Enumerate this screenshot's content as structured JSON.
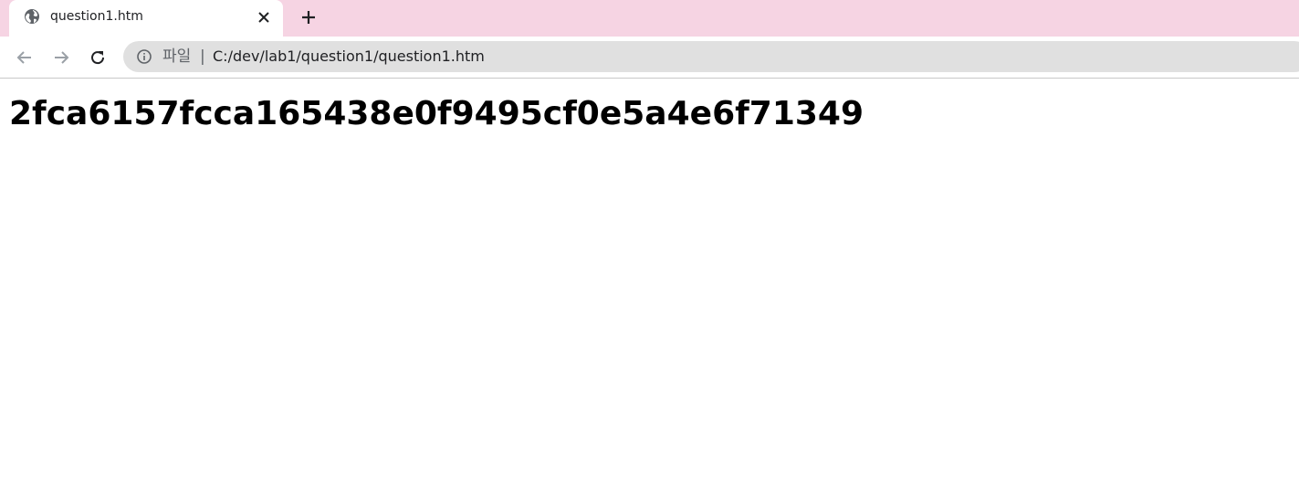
{
  "tab": {
    "title": "question1.htm",
    "favicon": "globe-icon",
    "close_icon": "close-icon"
  },
  "tabstrip": {
    "background_color": "#f6d4e3",
    "new_tab_icon": "plus-icon"
  },
  "toolbar": {
    "back_icon": "arrow-left-icon",
    "forward_icon": "arrow-right-icon",
    "reload_icon": "reload-icon"
  },
  "omnibox": {
    "security_icon": "info-icon",
    "scheme_label": "파일",
    "separator": "|",
    "url": "C:/dev/lab1/question1/question1.htm"
  },
  "page": {
    "heading": "2fca6157fcca165438e0f9495cf0e5a4e6f71349"
  }
}
